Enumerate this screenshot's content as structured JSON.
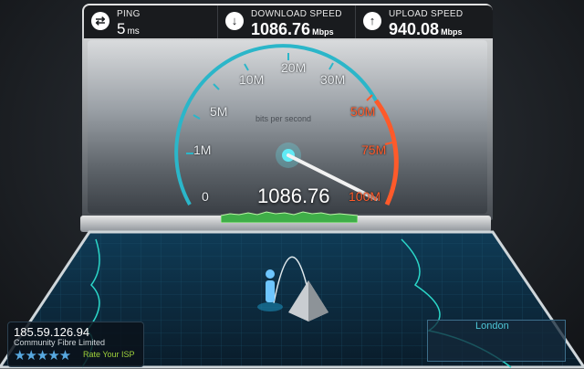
{
  "stats": {
    "ping": {
      "label": "PING",
      "value": "5",
      "unit": "ms",
      "icon": "ping-arrows-icon"
    },
    "download": {
      "label": "DOWNLOAD SPEED",
      "value": "1086.76",
      "unit": "Mbps",
      "icon": "download-arrow-icon"
    },
    "upload": {
      "label": "UPLOAD SPEED",
      "value": "940.08",
      "unit": "Mbps",
      "icon": "upload-arrow-icon"
    }
  },
  "gauge": {
    "caption": "bits per second",
    "current_value": "1086.76",
    "scale": [
      "0",
      "1M",
      "5M",
      "10M",
      "20M",
      "30M",
      "50M",
      "75M",
      "100M"
    ],
    "max_reached": true,
    "colors": {
      "arc": "#2bb6c9",
      "high_arc": "#ff5a2a"
    }
  },
  "server": {
    "ip": "185.59.126.94",
    "isp": "Community Fibre Limited",
    "rating_stars": 5,
    "rate_label": "Rate Your ISP",
    "location": "London"
  }
}
